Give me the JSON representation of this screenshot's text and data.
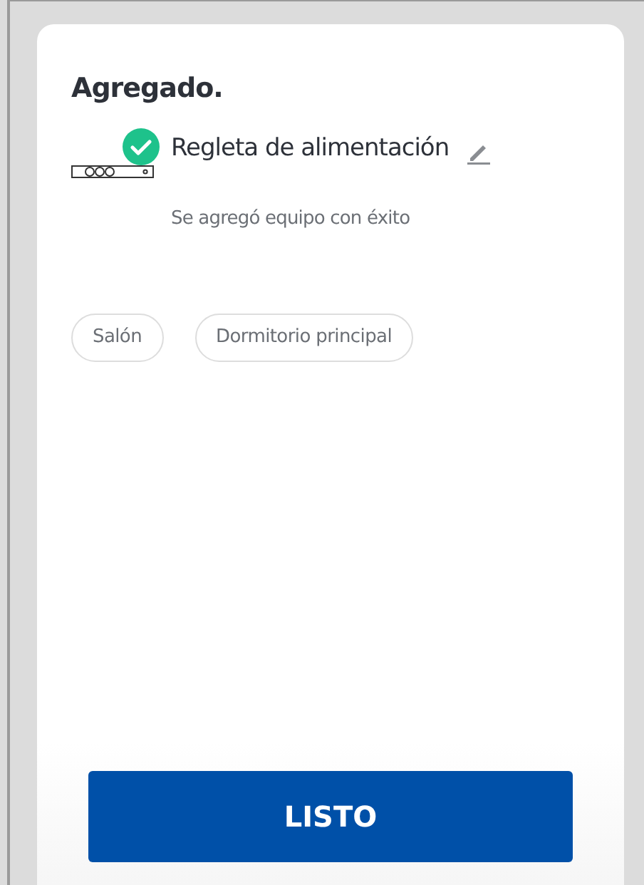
{
  "title": "Agregado.",
  "device": {
    "name": "Regleta de alimentación",
    "status": "Se agregó equipo con éxito",
    "added": true
  },
  "rooms": [
    {
      "label": "Salón",
      "selected": false
    },
    {
      "label": "Dormitorio principal",
      "selected": false
    }
  ],
  "button": "LISTO"
}
